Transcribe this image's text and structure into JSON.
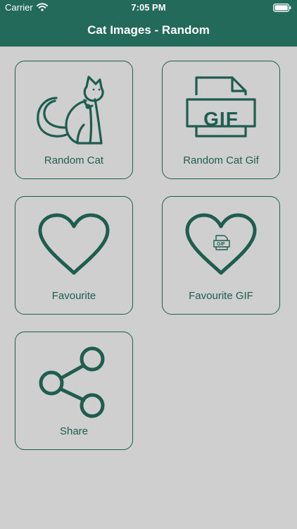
{
  "status_bar": {
    "carrier": "Carrier",
    "time": "7:05 PM"
  },
  "header": {
    "title": "Cat Images - Random"
  },
  "tiles": [
    {
      "label": "Random Cat",
      "icon": "cat-icon"
    },
    {
      "label": "Random Cat Gif",
      "icon": "gif-file-icon"
    },
    {
      "label": "Favourite",
      "icon": "heart-icon"
    },
    {
      "label": "Favourite GIF",
      "icon": "heart-gif-icon"
    },
    {
      "label": "Share",
      "icon": "share-icon"
    }
  ],
  "gif_badge": "GIF",
  "gif_badge_small": "GIF",
  "colors": {
    "header": "#236a5a",
    "accent": "#1f5d4f",
    "background": "#cfcfcf"
  }
}
